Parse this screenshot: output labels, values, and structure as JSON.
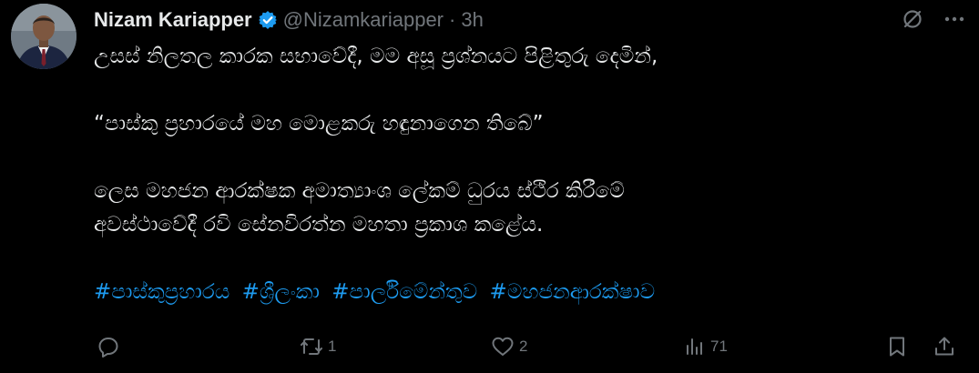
{
  "tweet": {
    "display_name": "Nizam Kariapper",
    "handle": "@Nizamkariapper",
    "separator": "·",
    "time": "3h",
    "icons": {
      "verified": "verified-badge-icon",
      "grok": "grok-icon",
      "more": "more-icon"
    },
    "body": {
      "line1": "උසස් නිලතල කාරක සභාවේදී, මම අසූ ප්‍රශ්නයට පිළිතුරු දෙමින්,",
      "quote": "“පාස්කු ප්‍රහාරයේ මහ මොළකරු හඳුනාගෙන තිබේ”",
      "line3": "ලෙස මහජන ආරක්ෂක අමාත්‍යාංශ ලේකම් ධුරය ස්ථිර කිරීමේ",
      "line4": "අවස්ථාවේදී රවි සේනවිරත්න මහතා ප්‍රකාශ කළේය."
    },
    "hashtags": [
      "#පාස්කුප්‍රහාරය",
      "#ශ්‍රීලංකා",
      "#පාර්ලිමේන්තුව",
      "#මහජනආරක්ෂාව"
    ],
    "accent_color": "#1d9bf0",
    "actions": {
      "reply_count": "",
      "retweet_count": "1",
      "like_count": "2",
      "views_count": "71"
    }
  }
}
